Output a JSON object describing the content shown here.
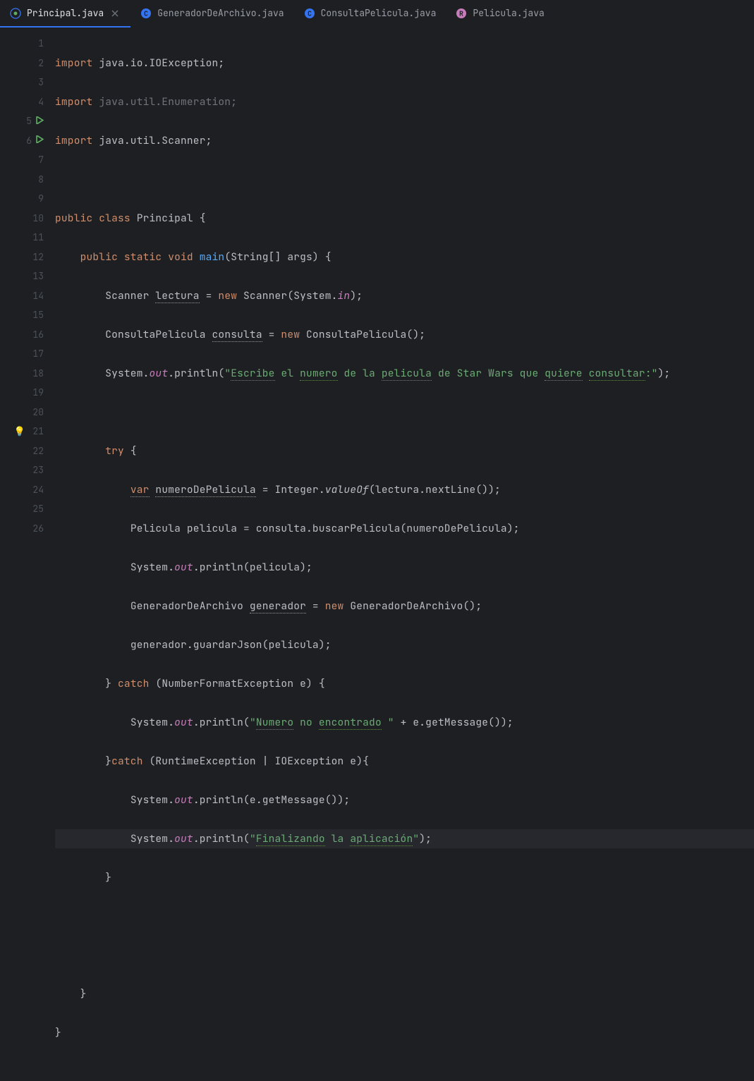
{
  "tabs": [
    {
      "name": "Principal.java",
      "active": true,
      "icon_color": "#3574f0"
    },
    {
      "name": "GeneradorDeArchivo.java",
      "active": false,
      "icon_color": "#3574f0"
    },
    {
      "name": "ConsultaPelicula.java",
      "active": false,
      "icon_color": "#3574f0"
    },
    {
      "name": "Pelicula.java",
      "active": false,
      "icon_color": "#c77dbb"
    }
  ],
  "lines": {
    "l1_a": "import",
    "l1_b": " java.io.IOException;",
    "l2_a": "import",
    "l2_b": " java.util.Enumeration;",
    "l3_a": "import",
    "l3_b": " java.util.Scanner;",
    "l5_a": "public class",
    "l5_b": " Principal {",
    "l6_a": "public static void",
    "l6_b": "main",
    "l6_c": "(String[] args) {",
    "l7_a": "Scanner ",
    "l7_b": "lectura",
    "l7_c": " = ",
    "l7_d": "new",
    "l7_e": " Scanner(System.",
    "l7_f": "in",
    "l7_g": ");",
    "l8_a": "ConsultaPelicula ",
    "l8_b": "consulta",
    "l8_c": " = ",
    "l8_d": "new",
    "l8_e": " ConsultaPelicula();",
    "l9_a": "System.",
    "l9_b": "out",
    "l9_c": ".println(",
    "l9_d": "\"",
    "l9_e": "Escribe",
    "l9_f": " el ",
    "l9_g": "numero",
    "l9_h": " de la ",
    "l9_i": "pelicula",
    "l9_j": " de Star Wars que ",
    "l9_k": "quiere",
    "l9_l": " ",
    "l9_m": "consultar",
    "l9_n": ":\"",
    "l9_o": ");",
    "l11_a": "try",
    "l11_b": " {",
    "l12_a": "var",
    "l12_b": " ",
    "l12_c": "numeroDePelicula",
    "l12_d": " = Integer.",
    "l12_e": "valueOf",
    "l12_f": "(lectura.nextLine());",
    "l13_a": "Pelicula pelicula = consulta.buscarPelicula(numeroDePelicula);",
    "l14_a": "System.",
    "l14_b": "out",
    "l14_c": ".println(pelicula);",
    "l15_a": "GeneradorDeArchivo ",
    "l15_b": "generador",
    "l15_c": " = ",
    "l15_d": "new",
    "l15_e": " GeneradorDeArchivo();",
    "l16_a": "generador.guardarJson(pelicula);",
    "l17_a": "} ",
    "l17_b": "catch",
    "l17_c": " (NumberFormatException e) {",
    "l18_a": "System.",
    "l18_b": "out",
    "l18_c": ".println(",
    "l18_d": "\"",
    "l18_e": "Numero",
    "l18_f": " no ",
    "l18_g": "encontrado",
    "l18_h": " \"",
    "l18_i": " + e.getMessage());",
    "l19_a": "}",
    "l19_b": "catch",
    "l19_c": " (RuntimeException | IOException e){",
    "l20_a": "System.",
    "l20_b": "out",
    "l20_c": ".println(e.getMessage());",
    "l21_a": "System.",
    "l21_b": "out",
    "l21_c": ".println(",
    "l21_d": "\"",
    "l21_e": "Finalizando",
    "l21_f": " la ",
    "l21_g": "aplicación",
    "l21_h": "\"",
    "l21_i": ");",
    "l22_a": "}",
    "l25_a": "}",
    "l26_a": "}"
  },
  "line_numbers": [
    "1",
    "2",
    "3",
    "4",
    "5",
    "6",
    "7",
    "8",
    "9",
    "10",
    "11",
    "12",
    "13",
    "14",
    "15",
    "16",
    "17",
    "18",
    "19",
    "20",
    "21",
    "22",
    "23",
    "24",
    "25",
    "26"
  ]
}
